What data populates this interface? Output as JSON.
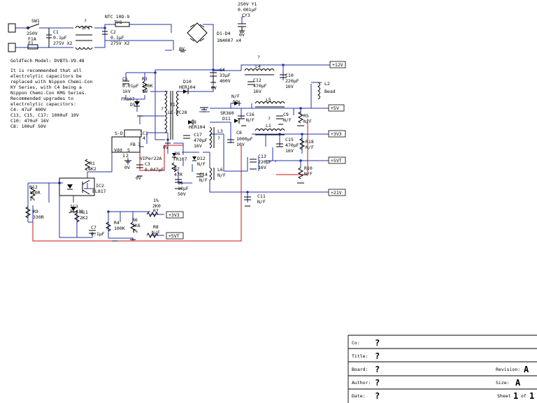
{
  "notes": {
    "model": "GoldTech Model: DVBTS-V9.48",
    "recommend": [
      "It is recommended that all",
      "electrolytic capacitors be",
      "replaced with Nippon Chemi-Con",
      "KY Series, with C4 being a",
      "Nippon Chemi-Con KMG Series.",
      "Recommended upgrades to",
      "electrolytic capacitors:",
      "C4: 47uF 400V",
      "C13, C15, C17: 1000uF 10V",
      "C10: 470uF 16V",
      "C8: 100uF 50V"
    ]
  },
  "labels": {
    "sw1": "SW1",
    "mains_v": "250V",
    "fuse_a": "F1A",
    "f1": "F1",
    "c1": "C1",
    "c1_val": "0.1µF",
    "c1_rating": "275V X2",
    "lf1": "LF1",
    "q_lf1": "?",
    "ntc": "NTC 10D-9",
    "th1": "TH1",
    "c2": "C2",
    "c2_val": "0.1µF",
    "c2_rating": "275V X2",
    "d1d4": "D1-D4",
    "d1d4_part": "1N4007 x4",
    "zero_v_bridge": "0V",
    "y1_rating": "250V Y1",
    "y1_val": "0.001µF",
    "cy3": "CY3",
    "zero_v_y": "0V",
    "c4": "C4",
    "c4_val": "33µF",
    "c4_v": "400V",
    "zero_v_c4": "0V",
    "c5": "C5",
    "c5_val": "0.01µF",
    "c5_v": "1kV",
    "r3": "R3",
    "r3_val": "100K",
    "r3_w": "1W",
    "d5_part": "FR107",
    "d5": "D5",
    "d10": "D10",
    "d10_part": "HER104",
    "t1": "T1",
    "t1_core": "LC-EC28",
    "q_t1": "?",
    "s_d": "S-D",
    "ic1": "IC1",
    "fb": "FB",
    "vdd": "Vdd",
    "s": "S",
    "pin1": "1",
    "pin2": "2",
    "pin3": "3",
    "pin4": "4",
    "ic1_part": "VIPer22A",
    "c3": "C3",
    "c3_val": "0.047µF",
    "zero_v_c3": "0V",
    "zero_v_ic1": "0V",
    "zero_v_t1": "0V",
    "d6": "D6",
    "d6_part": "FR107",
    "r2": "R2",
    "r2_val": "47R",
    "c6": "C6",
    "c6_val": "10µF",
    "c6_v": "50V",
    "d8": "D8",
    "d8_part": "HER104",
    "c17": "C17",
    "c17_val": "470µF",
    "c17_v": "16V",
    "d12": "D12",
    "d12_val": "N/F",
    "c14": "C14",
    "c14_val": "N/F",
    "l3": "L3",
    "q_l3": "?",
    "l6": "L6",
    "l6_val": "N/F",
    "l4": "L4",
    "q_l4": "?",
    "c12": "C12",
    "c12_val": "470µF",
    "c12_v": "16V",
    "c10": "C10",
    "c10_val": "220µF",
    "c10_v": "16V",
    "l2": "L2",
    "l2_val": "Bead",
    "d9_val": "N/F",
    "d9": "D9",
    "l5": "L5",
    "sr360": "SR360",
    "d11": "D11",
    "c16": "C16",
    "c16_val": "N/F",
    "c9": "C9",
    "c9_val": "N/F",
    "r5": "R5",
    "r5_val": "N/F",
    "c8": "C8",
    "c8_val": "1000µF",
    "c8_v": "10V",
    "l1": "L1",
    "q_l1": "?",
    "c15": "C15",
    "c15_val": "470µF",
    "c15_v": "16V",
    "r18": "R18",
    "r18_val": "N/F",
    "c13": "C13",
    "c13_val": "220µF",
    "c13_v": "16V",
    "r10": "R10",
    "r10_val": "N/F",
    "c11": "C11",
    "c11_val": "N/F",
    "r1": "R1",
    "r1_val": "8K2",
    "ic2": "IC2",
    "ic2_part": "EL817",
    "r12": "R12",
    "r12_val": "150R",
    "r12_tol": "1%",
    "r9": "R9",
    "r9_val": "330R",
    "ic3": "IC3",
    "ic3_part": "TL431",
    "r11": "R11",
    "r11_val": "2K2",
    "c7": "C7",
    "c7_val": "0.1µF",
    "r4": "R4",
    "r4_val": "100K",
    "r6": "R6",
    "r6_val": "5K6",
    "r6_tol": "1%",
    "r7_tol": "1%",
    "r7_val": "2K0",
    "r7": "R7",
    "r8": "R8",
    "r8_val": "N/F"
  },
  "rails": {
    "p12v": "+12V",
    "p5v": "+5V",
    "p3v3": "+3V3",
    "p5vt": "+5VT",
    "p21v": "+21V",
    "fb_3v3": "+3V3",
    "fb_5vt": "+5VT"
  },
  "titleblock": {
    "co_label": "Co:",
    "co_value": "?",
    "title_label": "Title:",
    "title_value": "?",
    "board_label": "Board:",
    "board_value": "?",
    "revision_label": "Revision:",
    "revision_value": "A",
    "author_label": "Author:",
    "author_value": "?",
    "size_label": "Size:",
    "size_value": "A",
    "date_label": "Date:",
    "date_value": "?",
    "sheet_label": "Sheet",
    "sheet_num": "1",
    "sheet_of": "of",
    "sheet_total": "1"
  }
}
